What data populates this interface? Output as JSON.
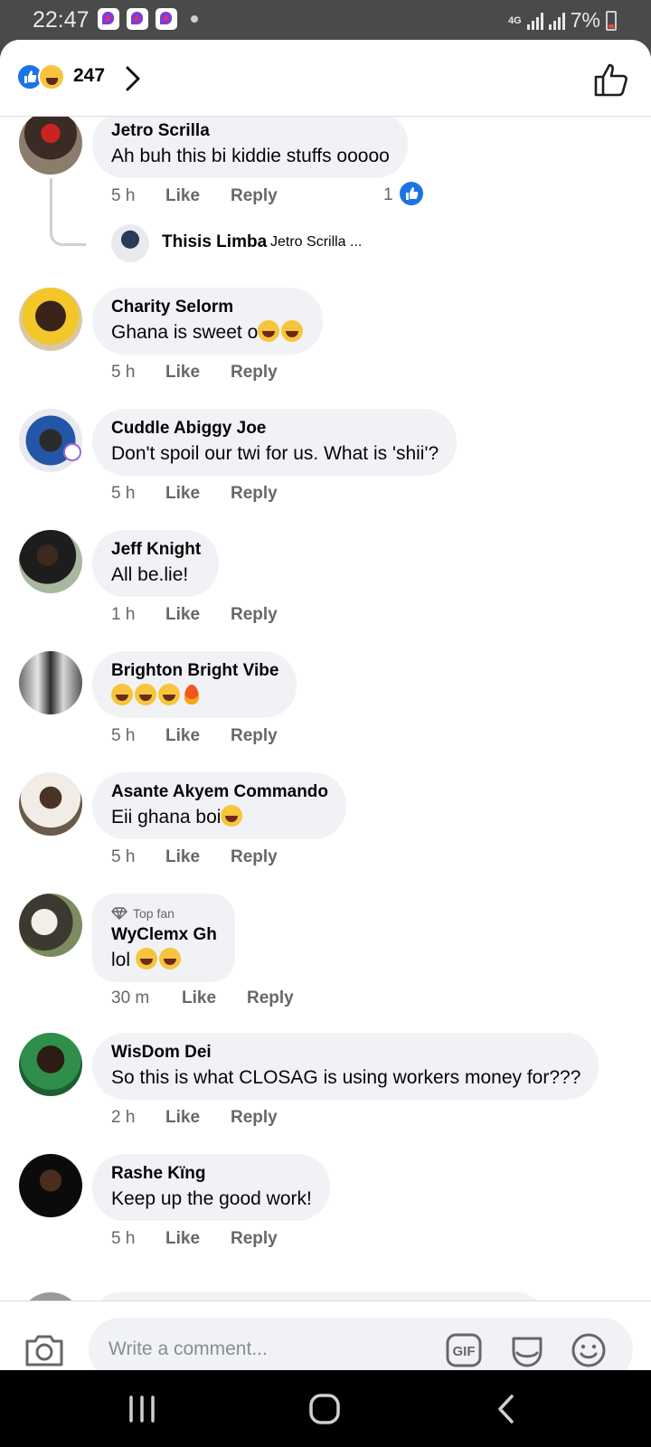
{
  "status_bar": {
    "time": "22:47",
    "battery": "7%",
    "network": "4G"
  },
  "header": {
    "reaction_count": "247",
    "reactions": [
      "like-icon",
      "haha-icon"
    ]
  },
  "comments": [
    {
      "author": "Jetro Scrilla",
      "text": "Ah buh this bi kiddie stuffs ooooo",
      "time": "5 h",
      "like_label": "Like",
      "reply_label": "Reply",
      "likes": "1",
      "reply": {
        "author": "Thisis Limba",
        "preview": "Jetro Scrilla ..."
      }
    },
    {
      "author": "Charity Selorm",
      "text": "Ghana is sweet o",
      "emojis": [
        "rofl",
        "rofl"
      ],
      "time": "5 h",
      "like_label": "Like",
      "reply_label": "Reply"
    },
    {
      "author": "Cuddle Abiggy Joe",
      "text": "Don't spoil our twi for us. What is 'shii'?",
      "time": "5 h",
      "like_label": "Like",
      "reply_label": "Reply"
    },
    {
      "author": "Jeff Knight",
      "text": "All be.lie!",
      "time": "1 h",
      "like_label": "Like",
      "reply_label": "Reply"
    },
    {
      "author": "Brighton Bright Vibe",
      "text": "",
      "emojis": [
        "rofl",
        "joy",
        "joy",
        "fire"
      ],
      "time": "5 h",
      "like_label": "Like",
      "reply_label": "Reply"
    },
    {
      "author": "Asante Akyem Commando",
      "text": "Eii ghana boi",
      "emojis": [
        "laughing"
      ],
      "time": "5 h",
      "like_label": "Like",
      "reply_label": "Reply"
    },
    {
      "badge": "Top fan",
      "author": "WyClemx Gh",
      "text": "lol ",
      "emojis": [
        "joy",
        "joy"
      ],
      "time": "30 m",
      "like_label": "Like",
      "reply_label": "Reply"
    },
    {
      "author": "WisDom Dei",
      "text": "So this is what CLOSAG is using workers money for???",
      "time": "2 h",
      "like_label": "Like",
      "reply_label": "Reply"
    },
    {
      "author": "Rashe Kïng",
      "text": "Keep up the good work!",
      "time": "5 h",
      "like_label": "Like",
      "reply_label": "Reply"
    }
  ],
  "composer": {
    "placeholder": "Write a comment...",
    "icons": [
      "camera-icon",
      "gif-icon",
      "sticker-icon",
      "emoji-icon"
    ]
  },
  "colors": {
    "facebook_blue": "#1b74e4",
    "bubble_bg": "#f0f2f5",
    "secondary_text": "#65676b",
    "status_bar_bg": "#4a4a4a"
  }
}
